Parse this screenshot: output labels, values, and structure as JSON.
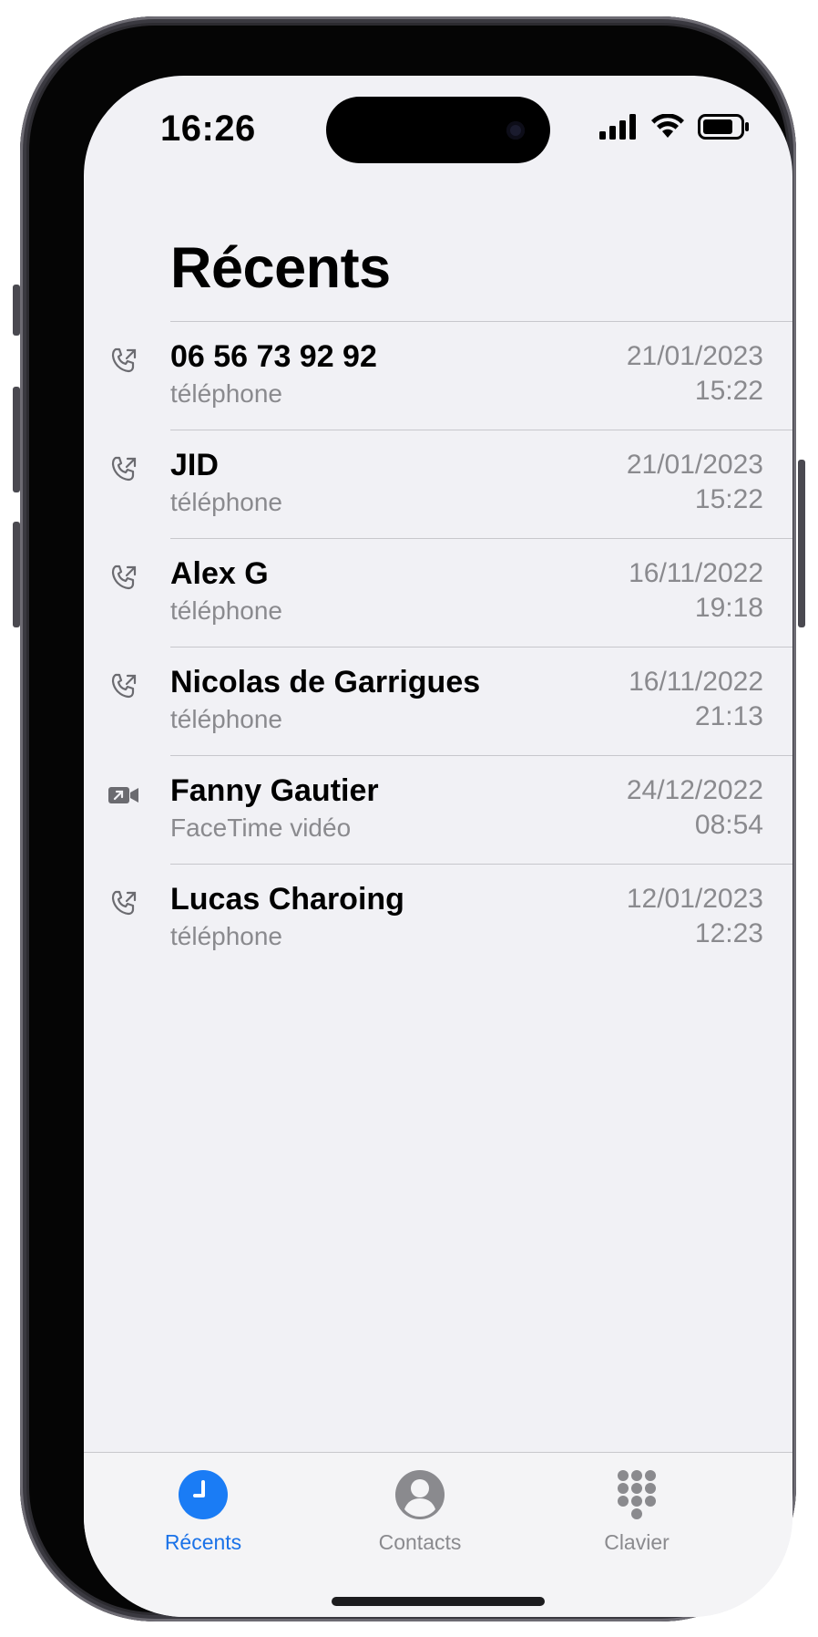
{
  "status_bar": {
    "time": "16:26",
    "signal_icon": "cellular-signal-icon",
    "wifi_icon": "wifi-icon",
    "battery_icon": "battery-icon"
  },
  "header": {
    "title": "Récents"
  },
  "calls": [
    {
      "name": "06 56 73 92 92",
      "kind": "téléphone",
      "date": "21/01/2023",
      "time": "15:22",
      "icon": "phone-outgoing-icon"
    },
    {
      "name": "JID",
      "kind": "téléphone",
      "date": "21/01/2023",
      "time": "15:22",
      "icon": "phone-outgoing-icon"
    },
    {
      "name": "Alex G",
      "kind": "téléphone",
      "date": "16/11/2022",
      "time": "19:18",
      "icon": "phone-outgoing-icon"
    },
    {
      "name": "Nicolas de Garrigues",
      "kind": "téléphone",
      "date": "16/11/2022",
      "time": "21:13",
      "icon": "phone-outgoing-icon"
    },
    {
      "name": "Fanny Gautier",
      "kind": "FaceTime vidéo",
      "date": "24/12/2022",
      "time": "08:54",
      "icon": "video-outgoing-icon"
    },
    {
      "name": "Lucas Charoing",
      "kind": "téléphone",
      "date": "12/01/2023",
      "time": "12:23",
      "icon": "phone-outgoing-icon"
    }
  ],
  "tabbar": {
    "tabs": [
      {
        "label": "Récents",
        "icon": "clock-icon",
        "active": true
      },
      {
        "label": "Contacts",
        "icon": "person-circle-icon",
        "active": false
      },
      {
        "label": "Clavier",
        "icon": "keypad-icon",
        "active": false
      }
    ]
  },
  "colors": {
    "accent": "#1a72e8",
    "secondary_text": "#8a8a8e",
    "background": "#f1f1f5"
  }
}
